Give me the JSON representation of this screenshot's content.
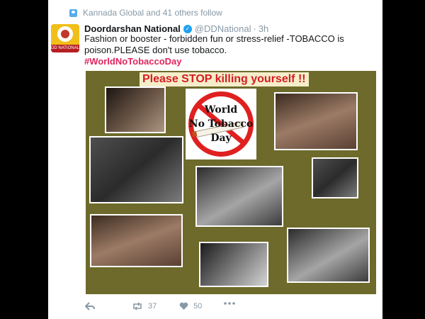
{
  "social_context": {
    "text": "Kannada Global and 41 others follow"
  },
  "tweet": {
    "avatar_label": "DD NATIONAL",
    "author_name": "Doordarshan National",
    "handle": "@DDNational",
    "separator": "·",
    "time": "3h",
    "text": "Fashion or booster - forbidden fun or stress-relief -TOBACCO is poison.PLEASE don't use tobacco.",
    "hashtag": "#WorldNoTobaccoDay"
  },
  "poster": {
    "headline": "Please STOP killing yourself !!",
    "logo_lines": [
      "World",
      "No Tobacco",
      "Day"
    ]
  },
  "actions": {
    "retweets": "37",
    "likes": "50"
  },
  "colors": {
    "hashtag": "#e0245e",
    "headline": "#d31e23",
    "poster_bg": "#6d6a2b",
    "verified": "#1da1f2"
  }
}
